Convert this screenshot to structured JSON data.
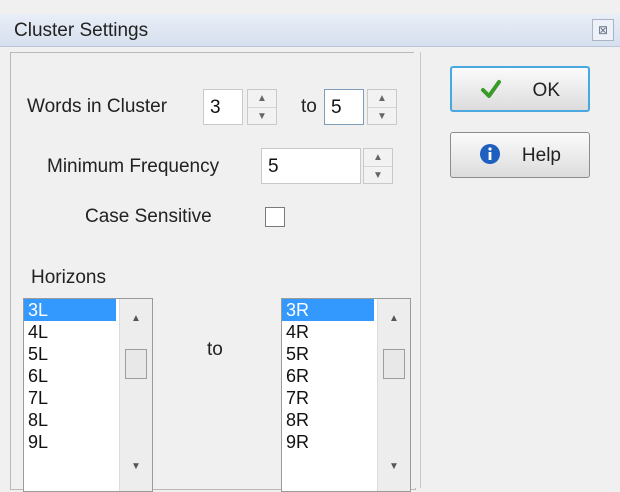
{
  "window": {
    "title": "Cluster Settings",
    "close_glyph": "⊠"
  },
  "words_in_cluster": {
    "label": "Words in Cluster",
    "from_value": "3",
    "to_label": "to",
    "to_value": "5"
  },
  "minimum_frequency": {
    "label": "Minimum Frequency",
    "value": "5"
  },
  "case_sensitive": {
    "label": "Case Sensitive",
    "checked": false
  },
  "horizons": {
    "label": "Horizons",
    "to_label": "to",
    "left_items": [
      "3L",
      "4L",
      "5L",
      "6L",
      "7L",
      "8L",
      "9L"
    ],
    "right_items": [
      "3R",
      "4R",
      "5R",
      "6R",
      "7R",
      "8R",
      "9R"
    ],
    "selected_left": "3L",
    "selected_right": "3R"
  },
  "buttons": {
    "ok": {
      "label": "OK",
      "icon": "checkmark-icon",
      "icon_color": "#3a9a2a"
    },
    "help": {
      "label": "Help",
      "icon": "info-icon",
      "icon_color": "#1f5fbf"
    }
  },
  "scroll_arrows": {
    "up": "▲",
    "down": "▼"
  }
}
